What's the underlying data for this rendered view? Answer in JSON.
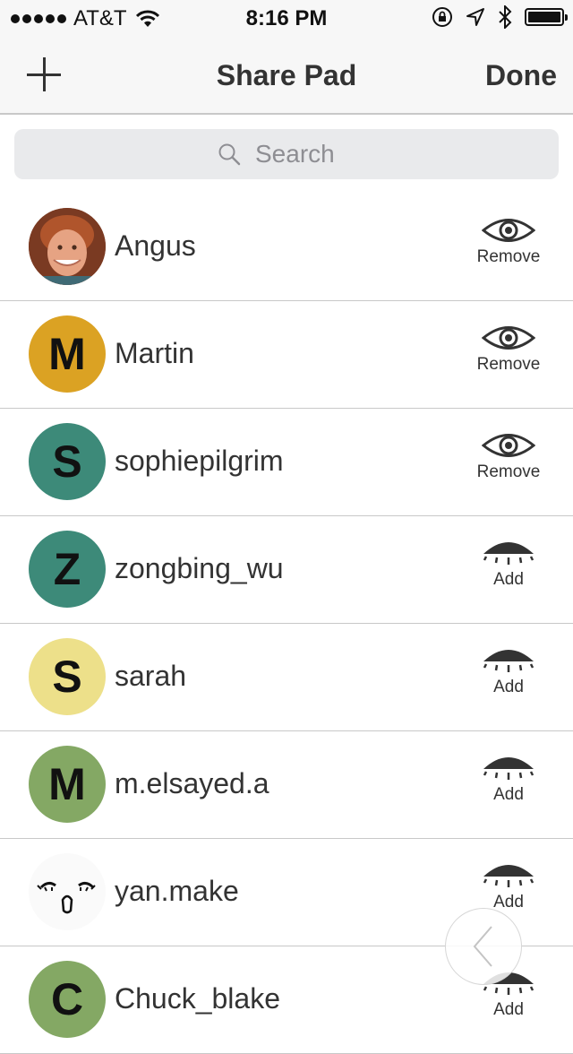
{
  "status_bar": {
    "carrier": "AT&T",
    "time": "8:16 PM"
  },
  "nav": {
    "title": "Share Pad",
    "done_label": "Done"
  },
  "search": {
    "placeholder": "Search"
  },
  "users": [
    {
      "name": "Angus",
      "avatar_type": "photo",
      "action": "Remove",
      "action_icon": "eye-open-icon"
    },
    {
      "name": "Martin",
      "avatar_letter": "M",
      "avatar_color": "#dba223",
      "action": "Remove",
      "action_icon": "eye-open-icon"
    },
    {
      "name": "sophiepilgrim",
      "avatar_letter": "S",
      "avatar_color": "#3d8a79",
      "action": "Remove",
      "action_icon": "eye-open-icon"
    },
    {
      "name": "zongbing_wu",
      "avatar_letter": "Z",
      "avatar_color": "#3d8a79",
      "action": "Add",
      "action_icon": "eye-closed-icon"
    },
    {
      "name": "sarah",
      "avatar_letter": "S",
      "avatar_color": "#ede08a",
      "action": "Add",
      "action_icon": "eye-closed-icon"
    },
    {
      "name": "m.elsayed.a",
      "avatar_letter": "M",
      "avatar_color": "#84a864",
      "action": "Add",
      "action_icon": "eye-closed-icon"
    },
    {
      "name": "yan.make",
      "avatar_type": "drawing",
      "action": "Add",
      "action_icon": "eye-closed-icon"
    },
    {
      "name": "Chuck_blake",
      "avatar_letter": "C",
      "avatar_color": "#84a864",
      "action": "Add",
      "action_icon": "eye-closed-icon"
    }
  ]
}
